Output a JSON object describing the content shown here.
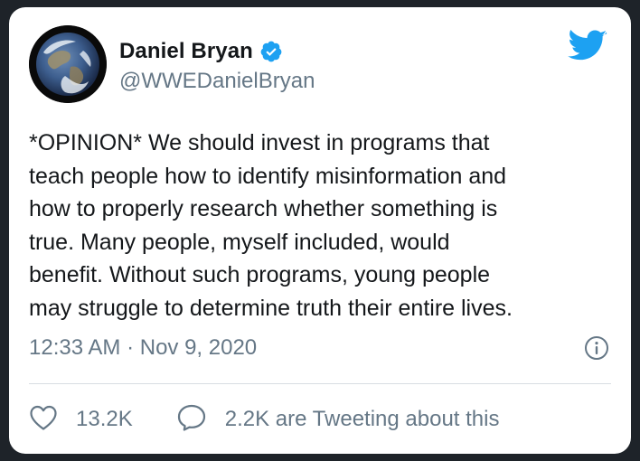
{
  "author": {
    "display_name": "Daniel Bryan",
    "handle": "@WWEDanielBryan",
    "verified": true,
    "avatar": "earth-photo-avatar"
  },
  "tweet": {
    "lines": [
      "*OPINION* We should invest in programs that",
      "teach people how to identify misinformation and",
      "how to properly research whether something is",
      "true. Many people, myself included, would",
      "benefit. Without such programs, young people",
      "may struggle to determine truth their entire lives."
    ],
    "timestamp": "12:33 AM · Nov 9, 2020"
  },
  "actions": {
    "likes": "13.2K",
    "tweeting_about": "2.2K are Tweeting about this"
  },
  "icons": {
    "brand": "twitter-bird-icon",
    "verified": "verified-badge-icon",
    "info": "info-icon",
    "like": "heart-icon",
    "reply": "speech-bubble-icon"
  },
  "colors": {
    "brand_blue": "#1da1f2",
    "secondary_text": "#657786",
    "primary_text": "#14171a",
    "background": "#1e2329"
  }
}
